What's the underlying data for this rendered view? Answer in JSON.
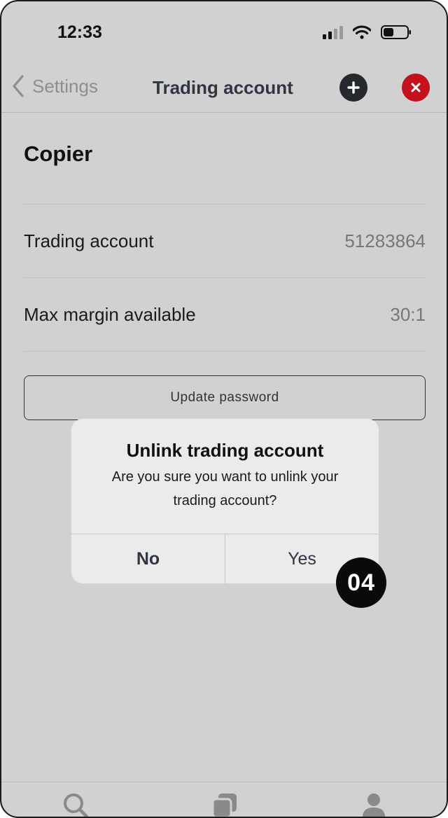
{
  "status_bar": {
    "time": "12:33",
    "icons": [
      "cellular-signal-icon",
      "wifi-icon",
      "battery-icon"
    ]
  },
  "nav": {
    "back_label": "Settings",
    "title": "Trading account",
    "add_icon": "plus-icon",
    "close_icon": "close-icon"
  },
  "content": {
    "section_title": "Copier",
    "rows": [
      {
        "label": "Trading account",
        "value": "51283864"
      },
      {
        "label": "Max margin available",
        "value": "30:1"
      }
    ],
    "update_password_label": "Update password"
  },
  "dialog": {
    "title": "Unlink trading account",
    "message": "Are you sure you want to unlink your trading account?",
    "no_label": "No",
    "yes_label": "Yes"
  },
  "step_badge": "04",
  "tab_bar": {
    "icons": [
      "search-icon",
      "copy-icon",
      "profile-icon"
    ]
  },
  "colors": {
    "background": "#d1d1d1",
    "close_button": "#c4121c",
    "add_button": "#26292e",
    "dialog_bg": "#ebebeb"
  }
}
